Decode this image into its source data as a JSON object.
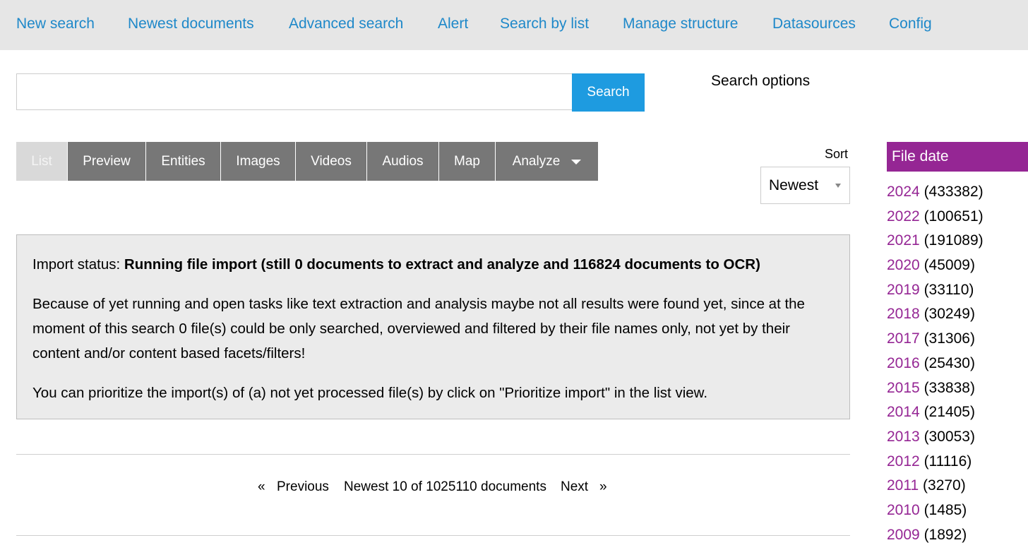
{
  "nav": {
    "items": [
      {
        "label": "New search"
      },
      {
        "label": "Newest documents"
      },
      {
        "label": "Advanced search"
      },
      {
        "label": "Alert"
      },
      {
        "label": "Search by list"
      },
      {
        "label": "Manage structure"
      },
      {
        "label": "Datasources"
      },
      {
        "label": "Config"
      }
    ]
  },
  "search": {
    "value": "",
    "placeholder": "",
    "button_label": "Search",
    "options_label": "Search options"
  },
  "tabs": {
    "items": [
      {
        "label": "List",
        "active": true
      },
      {
        "label": "Preview"
      },
      {
        "label": "Entities"
      },
      {
        "label": "Images"
      },
      {
        "label": "Videos"
      },
      {
        "label": "Audios"
      },
      {
        "label": "Map"
      },
      {
        "label": "Analyze",
        "dropdown": true
      }
    ]
  },
  "sort": {
    "label": "Sort",
    "selected": "Newest"
  },
  "status": {
    "prefix": "Import status: ",
    "headline": "Running file import (still 0 documents to extract and analyze and 116824 documents to OCR)",
    "message": "Because of yet running and open tasks like text extraction and analysis maybe not all results were found yet, since at the moment of this search 0 file(s) could be only searched, overviewed and filtered by their file names only, not yet by their content and/or content based facets/filters!",
    "hint": "You can prioritize the import(s) of (a) not yet processed file(s) by click on \"Prioritize import\" in the list view."
  },
  "pager": {
    "prev_arrow": "«",
    "prev_label": "Previous",
    "summary": "Newest 10 of 1025110 documents",
    "next_label": "Next",
    "next_arrow": "»"
  },
  "facet": {
    "title": "File date",
    "items": [
      {
        "year": "2024",
        "count": "(433382)"
      },
      {
        "year": "2022",
        "count": "(100651)"
      },
      {
        "year": "2021",
        "count": "(191089)"
      },
      {
        "year": "2020",
        "count": "(45009)"
      },
      {
        "year": "2019",
        "count": "(33110)"
      },
      {
        "year": "2018",
        "count": "(30249)"
      },
      {
        "year": "2017",
        "count": "(31306)"
      },
      {
        "year": "2016",
        "count": "(25430)"
      },
      {
        "year": "2015",
        "count": "(33838)"
      },
      {
        "year": "2014",
        "count": "(21405)"
      },
      {
        "year": "2013",
        "count": "(30053)"
      },
      {
        "year": "2012",
        "count": "(11116)"
      },
      {
        "year": "2011",
        "count": "(3270)"
      },
      {
        "year": "2010",
        "count": "(1485)"
      },
      {
        "year": "2009",
        "count": "(1892)"
      }
    ]
  },
  "colors": {
    "link_blue": "#1e88c9",
    "button_blue": "#1e9be0",
    "facet_purple": "#952694",
    "tab_gray": "#777777"
  }
}
